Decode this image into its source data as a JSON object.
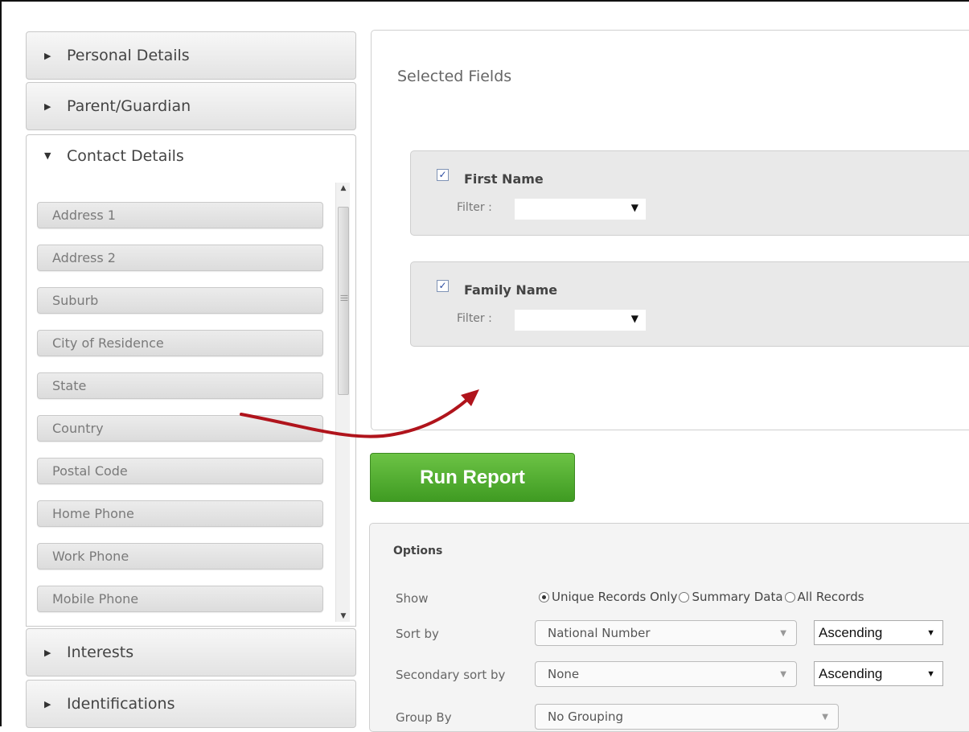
{
  "accordion": {
    "sections": [
      {
        "label": "Personal Details",
        "open": false
      },
      {
        "label": "Parent/Guardian",
        "open": false
      },
      {
        "label": "Contact Details",
        "open": true
      },
      {
        "label": "Interests",
        "open": false
      },
      {
        "label": "Identifications",
        "open": false
      }
    ],
    "contact_fields": [
      "Address 1",
      "Address 2",
      "Suburb",
      "City of Residence",
      "State",
      "Country",
      "Postal Code",
      "Home Phone",
      "Work Phone",
      "Mobile Phone"
    ]
  },
  "selected": {
    "title": "Selected Fields",
    "fields": [
      {
        "name": "First Name",
        "filter_label": "Filter :",
        "checked": true
      },
      {
        "name": "Family Name",
        "filter_label": "Filter :",
        "checked": true
      }
    ]
  },
  "run_button": "Run Report",
  "options": {
    "title": "Options",
    "show_label": "Show",
    "show_choices": [
      "Unique Records Only",
      "Summary Data",
      "All Records"
    ],
    "show_selected": "Unique Records Only",
    "sort_label": "Sort by",
    "sort_value": "National Number",
    "sort_order": "Ascending",
    "secondary_label": "Secondary sort by",
    "secondary_value": "None",
    "secondary_order": "Ascending",
    "group_label": "Group By",
    "group_value": "No Grouping"
  },
  "colors": {
    "run_button": "#4caf2f",
    "arrow": "#b0141c"
  }
}
